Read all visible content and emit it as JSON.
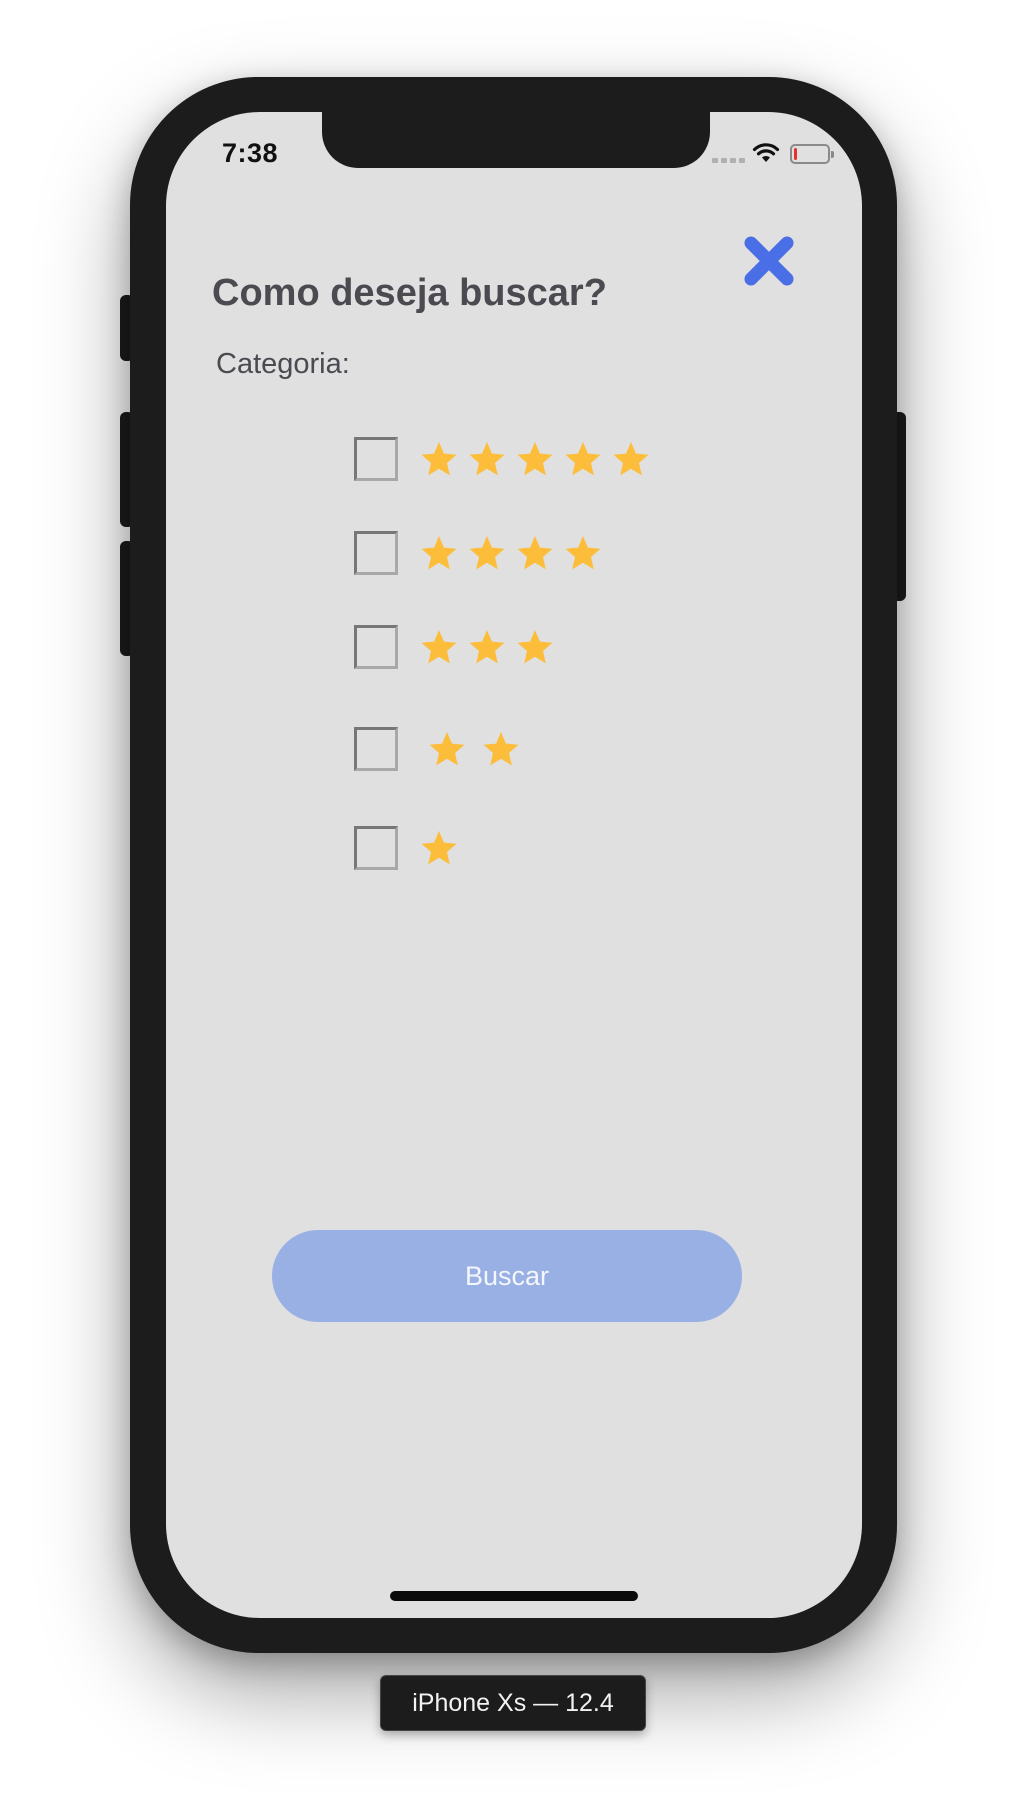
{
  "status_bar": {
    "time": "7:38",
    "battery_level_percent": 10
  },
  "modal": {
    "title": "Como deseja buscar?",
    "subtitle": "Categoria:",
    "close_icon": "close-x-icon",
    "accent_color": "#4a6ee6",
    "star_color": "#fcbd3a"
  },
  "rating_options": [
    {
      "stars": 5,
      "checked": false
    },
    {
      "stars": 4,
      "checked": false
    },
    {
      "stars": 3,
      "checked": false
    },
    {
      "stars": 2,
      "checked": false
    },
    {
      "stars": 1,
      "checked": false
    }
  ],
  "search_button": {
    "label": "Buscar",
    "color": "#98b0e4"
  },
  "device_label": "iPhone Xs — 12.4"
}
